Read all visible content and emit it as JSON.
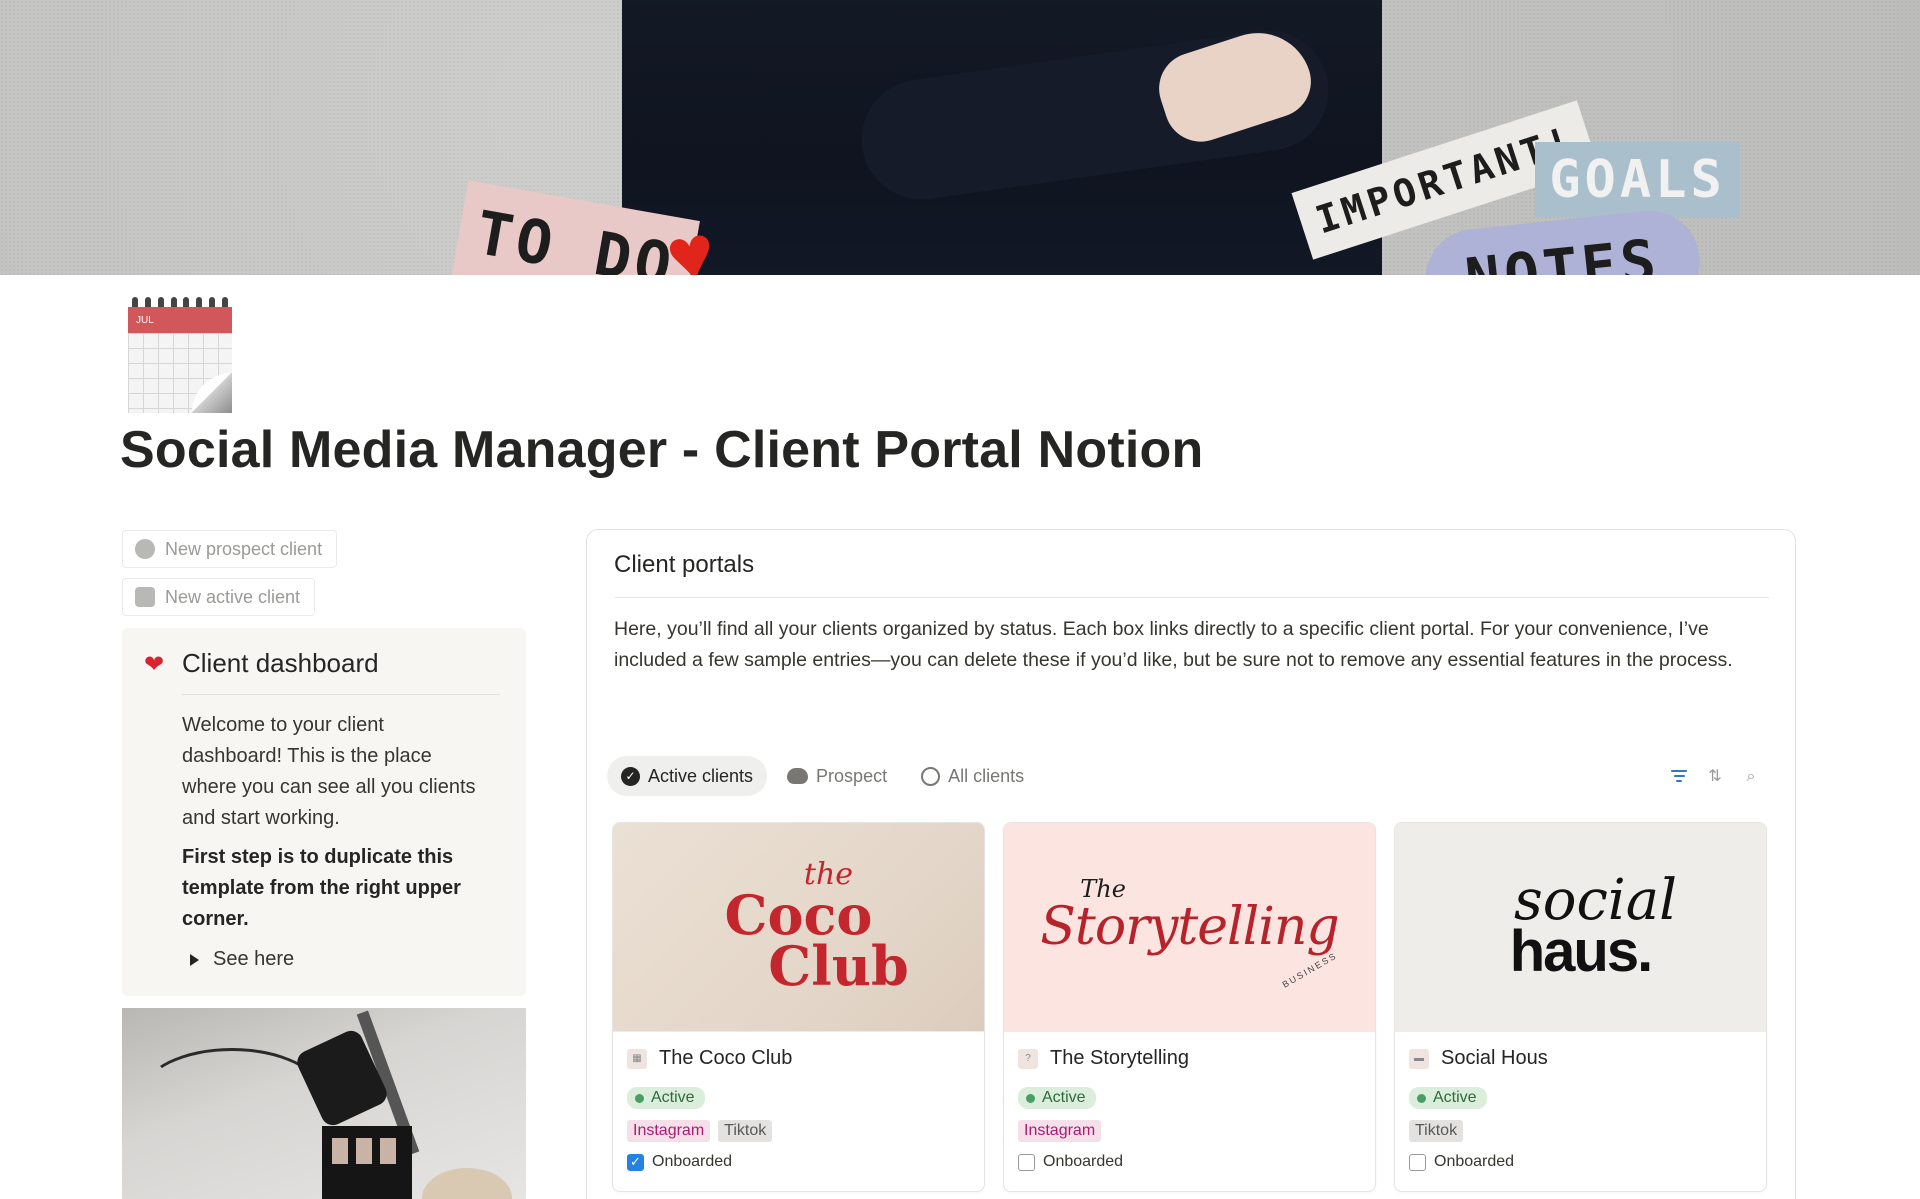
{
  "cover": {
    "stickers": [
      "TO DO",
      "IMPORTANT!",
      "GOALS",
      "NOTES"
    ],
    "heart_icon": "heart-icon"
  },
  "page": {
    "icon": "calendar-icon",
    "icon_month": "JUL",
    "title": "Social Media Manager - Client Portal Notion"
  },
  "left": {
    "new_prospect_label": "New prospect client",
    "new_active_label": "New active client",
    "dashboard": {
      "title": "Client dashboard",
      "icon": "heart-icon",
      "welcome": "Welcome to your client dashboard! This is the place where you can see all you clients and start working.",
      "first_step": "First step is to duplicate this template from the right upper corner.",
      "toggle_label": "See here"
    }
  },
  "portals": {
    "title": "Client portals",
    "description": "Here, you’ll find all your clients organized by status. Each box links directly to a specific client portal. For your convenience, I’ve included a few sample entries—you can delete these if you’d like, but be sure not to remove any essential features in the process.",
    "tabs": [
      {
        "label": "Active clients",
        "icon": "verified-check-icon",
        "active": true
      },
      {
        "label": "Prospect",
        "icon": "cloud-icon",
        "active": false
      },
      {
        "label": "All clients",
        "icon": "circle-icon",
        "active": false
      }
    ],
    "tools": [
      "filter-icon",
      "sort-icon",
      "search-icon"
    ],
    "accent_color": "#2383e2",
    "cards": [
      {
        "name": "The Coco Club",
        "logo": {
          "small": "the",
          "line1": "Coco",
          "line2": "Club"
        },
        "status": "Active",
        "tags": [
          "Instagram",
          "Tiktok"
        ],
        "onboarded_label": "Onboarded",
        "onboarded": true
      },
      {
        "name": "The Storytelling",
        "logo": {
          "small": "The",
          "main": "Storytelling",
          "sub": "BUSINESS"
        },
        "status": "Active",
        "tags": [
          "Instagram"
        ],
        "onboarded_label": "Onboarded",
        "onboarded": false
      },
      {
        "name": "Social Hous",
        "logo": {
          "line1": "social",
          "line2": "haus."
        },
        "status": "Active",
        "tags": [
          "Tiktok"
        ],
        "onboarded_label": "Onboarded",
        "onboarded": false
      }
    ]
  }
}
